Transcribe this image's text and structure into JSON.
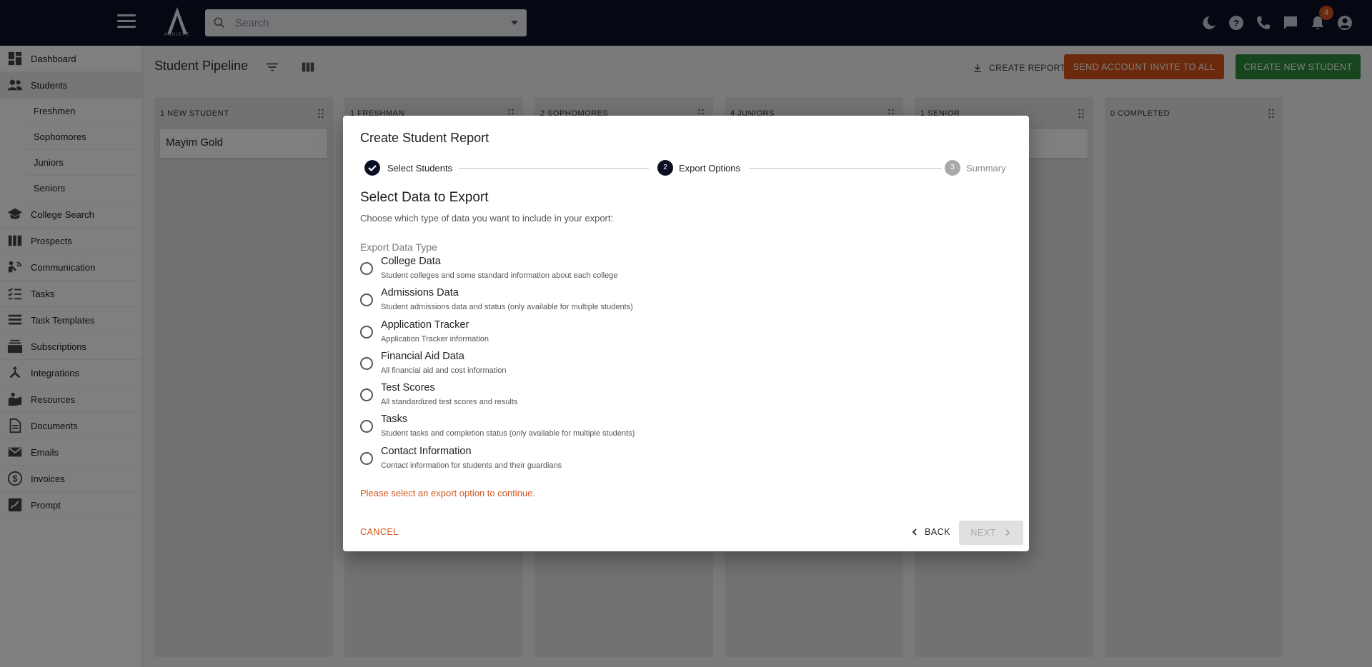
{
  "topbar": {
    "logo_text": "ACHIEVE",
    "search_placeholder": "Search",
    "notification_count": "4",
    "icons": [
      "moon-icon",
      "help-icon",
      "phone-icon",
      "chat-icon",
      "bell-icon",
      "account-icon"
    ]
  },
  "sidebar": {
    "items": [
      {
        "label": "Dashboard",
        "icon": "dashboard-icon"
      },
      {
        "label": "Students",
        "icon": "students-icon"
      },
      {
        "label": "College Search",
        "icon": "graduation-cap-icon"
      },
      {
        "label": "Prospects",
        "icon": "prospects-icon"
      },
      {
        "label": "Communication",
        "icon": "communication-icon"
      },
      {
        "label": "Tasks",
        "icon": "tasks-icon"
      },
      {
        "label": "Task Templates",
        "icon": "task-templates-icon"
      },
      {
        "label": "Subscriptions",
        "icon": "subscriptions-icon"
      },
      {
        "label": "Integrations",
        "icon": "integrations-icon"
      },
      {
        "label": "Resources",
        "icon": "resources-icon"
      },
      {
        "label": "Documents",
        "icon": "documents-icon"
      },
      {
        "label": "Emails",
        "icon": "email-icon"
      },
      {
        "label": "Invoices",
        "icon": "invoices-icon"
      },
      {
        "label": "Prompt",
        "icon": "prompt-icon"
      }
    ],
    "sub_items": [
      "Freshmen",
      "Sophomores",
      "Juniors",
      "Seniors"
    ]
  },
  "main": {
    "title": "Student Pipeline",
    "create_report": "CREATE REPORT",
    "send_invite": "SEND ACCOUNT INVITE TO ALL",
    "create_student": "CREATE NEW STUDENT",
    "columns": [
      {
        "header": "1 NEW STUDENT",
        "cards": [
          "Mayim Gold"
        ]
      },
      {
        "header": "1 FRESHMAN",
        "cards": []
      },
      {
        "header": "2 SOPHOMORES",
        "cards": []
      },
      {
        "header": "4 JUNIORS",
        "cards": []
      },
      {
        "header": "1 SENIOR",
        "cards": []
      },
      {
        "header": "0 COMPLETED",
        "cards": []
      }
    ]
  },
  "dialog": {
    "title": "Create Student Report",
    "steps": [
      {
        "number": "1",
        "label": "Select Students",
        "state": "done"
      },
      {
        "number": "2",
        "label": "Export Options",
        "state": "active"
      },
      {
        "number": "3",
        "label": "Summary",
        "state": "pending"
      }
    ],
    "section_title": "Select Data to Export",
    "section_desc": "Choose which type of data you want to include in your export:",
    "legend": "Export Data Type",
    "options": [
      {
        "label": "College Data",
        "desc": "Student colleges and some standard information about each college"
      },
      {
        "label": "Admissions Data",
        "desc": "Student admissions data and status (only available for multiple students)"
      },
      {
        "label": "Application Tracker",
        "desc": "Application Tracker information"
      },
      {
        "label": "Financial Aid Data",
        "desc": "All financial aid and cost information"
      },
      {
        "label": "Test Scores",
        "desc": "All standardized test scores and results"
      },
      {
        "label": "Tasks",
        "desc": "Student tasks and completion status (only available for multiple students)"
      },
      {
        "label": "Contact Information",
        "desc": "Contact information for students and their guardians"
      }
    ],
    "warning": "Please select an export option to continue.",
    "cancel": "CANCEL",
    "back": "BACK",
    "next": "NEXT"
  },
  "colors": {
    "topbar": "#0b0f24",
    "accent_orange": "#d6541a",
    "accent_green": "#2e8b3a",
    "step_active": "#0b0f24"
  }
}
